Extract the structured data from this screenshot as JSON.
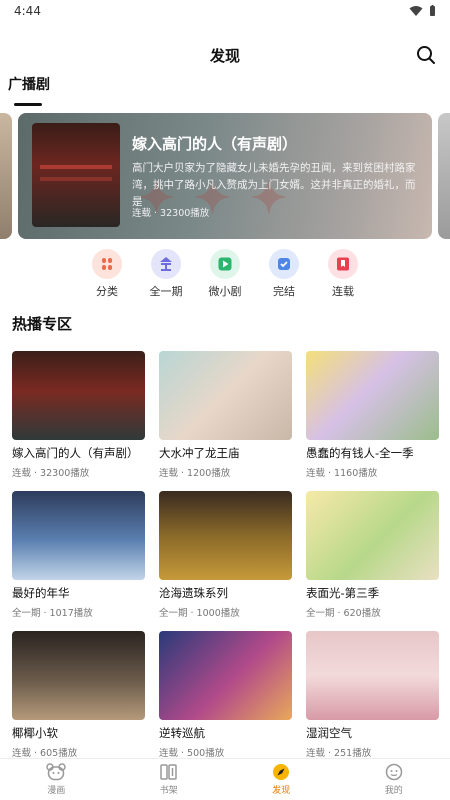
{
  "status": {
    "time": "4:44",
    "wifi_icon": "wifi-icon",
    "battery_icon": "battery-icon"
  },
  "header": {
    "title": "发现",
    "search_icon": "search-icon"
  },
  "tabs": [
    {
      "label": "广播剧",
      "active": true
    }
  ],
  "banner": {
    "title": "嫁入高门的人（有声剧）",
    "description": "高门大户贝家为了隐藏女儿未婚先孕的丑闻，来到贫困村路家湾，挑中了路小凡入赘成为上门女婿。这并非真正的婚礼，而是",
    "meta": "连载 · 32300播放"
  },
  "categories": [
    {
      "label": "分类",
      "icon": "category-icon",
      "color": "#fde3dc"
    },
    {
      "label": "全一期",
      "icon": "complete-icon",
      "color": "#e4e4fb"
    },
    {
      "label": "微小剧",
      "icon": "play-icon",
      "color": "#dff5ea"
    },
    {
      "label": "完结",
      "icon": "finished-icon",
      "color": "#dfe9fb"
    },
    {
      "label": "连载",
      "icon": "bookmark-icon",
      "color": "#fde0e4"
    }
  ],
  "section": {
    "title": "热播专区"
  },
  "cards": [
    {
      "title": "嫁入高门的人（有声剧）",
      "meta": "连载 · 32300播放"
    },
    {
      "title": "大水冲了龙王庙",
      "meta": "连载 · 1200播放"
    },
    {
      "title": "愚蠢的有钱人-全一季",
      "meta": "连载 · 1160播放"
    },
    {
      "title": "最好的年华",
      "meta": "全一期 · 1017播放"
    },
    {
      "title": "沧海遗珠系列",
      "meta": "全一期 · 1000播放"
    },
    {
      "title": "表面光-第三季",
      "meta": "全一期 · 620播放"
    },
    {
      "title": "椰椰小软",
      "meta": "连载 · 605播放"
    },
    {
      "title": "逆转巡航",
      "meta": "连载 · 500播放"
    },
    {
      "title": "湿润空气",
      "meta": "连载 · 251播放"
    }
  ],
  "nav": [
    {
      "label": "漫画",
      "icon": "bear-icon",
      "active": false
    },
    {
      "label": "书架",
      "icon": "bookshelf-icon",
      "active": false
    },
    {
      "label": "发现",
      "icon": "compass-icon",
      "active": true
    },
    {
      "label": "我的",
      "icon": "profile-icon",
      "active": false
    }
  ]
}
